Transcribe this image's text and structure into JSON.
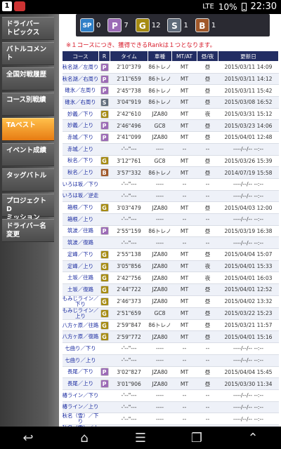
{
  "status_bar": {
    "badge": "1",
    "signal": "LTE",
    "battery": "10%",
    "time": "22:30"
  },
  "sidebar": {
    "items": [
      {
        "label": "ドライバー\nトピックス"
      },
      {
        "label": "バトルコメント"
      },
      {
        "label": "全国対戦履歴"
      },
      {
        "label": "コース別戦績"
      },
      {
        "label": "TAベスト"
      },
      {
        "label": "イベント成績"
      },
      {
        "label": "タッグバトル"
      },
      {
        "label": "プロジェクトD\nミッション"
      },
      {
        "label": "ドライバー名\n変更"
      }
    ]
  },
  "ranks": [
    {
      "letter": "SP",
      "count": "0",
      "color": "#2f7fc7"
    },
    {
      "letter": "P",
      "count": "7",
      "color": "#9c6bb6"
    },
    {
      "letter": "G",
      "count": "12",
      "color": "#a68b12"
    },
    {
      "letter": "S",
      "count": "1",
      "color": "#5f6b7a"
    },
    {
      "letter": "B",
      "count": "1",
      "color": "#a0582a"
    }
  ],
  "note": "※１コースにつき、獲得できるRankは１つとなります。",
  "table": {
    "headers": [
      "コース",
      "R",
      "タイム",
      "車種",
      "MT/AT",
      "昼/夜",
      "更新日"
    ],
    "rows": [
      {
        "course": "秋名湖／左周り",
        "rank": "P",
        "time": "2'10\"379",
        "car": "86トレノ",
        "mt": "MT",
        "daynight": "昼",
        "date": "2015/03/11 14:09"
      },
      {
        "course": "秋名湖／右周り",
        "rank": "P",
        "time": "2'11\"659",
        "car": "86トレノ",
        "mt": "MT",
        "daynight": "昼",
        "date": "2015/03/11 14:12"
      },
      {
        "course": "碓氷／左周り",
        "rank": "P",
        "time": "2'45\"738",
        "car": "86トレノ",
        "mt": "MT",
        "daynight": "昼",
        "date": "2015/03/11 15:42"
      },
      {
        "course": "碓氷／右周り",
        "rank": "S",
        "time": "3'04\"919",
        "car": "86トレノ",
        "mt": "MT",
        "daynight": "昼",
        "date": "2015/03/08 16:52"
      },
      {
        "course": "妙義／下り",
        "rank": "G",
        "time": "2'42\"610",
        "car": "JZA80",
        "mt": "MT",
        "daynight": "夜",
        "date": "2015/03/31 15:12"
      },
      {
        "course": "妙義／上り",
        "rank": "P",
        "time": "2'46\"496",
        "car": "GC8",
        "mt": "MT",
        "daynight": "昼",
        "date": "2015/03/23 14:06"
      },
      {
        "course": "赤城／下り",
        "rank": "P",
        "time": "2'41\"099",
        "car": "JZA80",
        "mt": "MT",
        "daynight": "昼",
        "date": "2015/04/01 12:48"
      },
      {
        "course": "赤城／上り",
        "rank": "",
        "time": "-'--\"---",
        "car": "----",
        "mt": "--",
        "daynight": "--",
        "date": "----/--/-- --:--"
      },
      {
        "course": "秋名／下り",
        "rank": "G",
        "time": "3'12\"761",
        "car": "GC8",
        "mt": "MT",
        "daynight": "昼",
        "date": "2015/03/26 15:39"
      },
      {
        "course": "秋名／上り",
        "rank": "B",
        "time": "3'57\"332",
        "car": "86トレノ",
        "mt": "MT",
        "daynight": "昼",
        "date": "2014/07/19 15:58"
      },
      {
        "course": "いろは坂／下り",
        "rank": "",
        "time": "-'--\"---",
        "car": "----",
        "mt": "--",
        "daynight": "--",
        "date": "----/--/-- --:--"
      },
      {
        "course": "いろは坂／逆走",
        "rank": "",
        "time": "-'--\"---",
        "car": "----",
        "mt": "--",
        "daynight": "--",
        "date": "----/--/-- --:--"
      },
      {
        "course": "箱根／下り",
        "rank": "G",
        "time": "3'03\"479",
        "car": "JZA80",
        "mt": "MT",
        "daynight": "昼",
        "date": "2015/04/03 12:00"
      },
      {
        "course": "箱根／上り",
        "rank": "",
        "time": "-'--\"---",
        "car": "----",
        "mt": "--",
        "daynight": "--",
        "date": "----/--/-- --:--"
      },
      {
        "course": "筑波／往路",
        "rank": "P",
        "time": "2'55\"159",
        "car": "86トレノ",
        "mt": "MT",
        "daynight": "昼",
        "date": "2015/03/19 16:38"
      },
      {
        "course": "筑波／復路",
        "rank": "",
        "time": "-'--\"---",
        "car": "----",
        "mt": "--",
        "daynight": "--",
        "date": "----/--/-- --:--"
      },
      {
        "course": "定峰／下り",
        "rank": "G",
        "time": "2'55\"138",
        "car": "JZA80",
        "mt": "MT",
        "daynight": "昼",
        "date": "2015/04/04 15:07"
      },
      {
        "course": "定峰／上り",
        "rank": "G",
        "time": "3'05\"856",
        "car": "JZA80",
        "mt": "MT",
        "daynight": "夜",
        "date": "2015/04/01 15:33"
      },
      {
        "course": "土坂／往路",
        "rank": "G",
        "time": "2'42\"756",
        "car": "JZA80",
        "mt": "MT",
        "daynight": "夜",
        "date": "2015/04/01 16:03"
      },
      {
        "course": "土坂／復路",
        "rank": "G",
        "time": "2'44\"722",
        "car": "JZA80",
        "mt": "MT",
        "daynight": "昼",
        "date": "2015/04/01 12:52"
      },
      {
        "course": "もみじライン／下り",
        "rank": "G",
        "time": "2'46\"373",
        "car": "JZA80",
        "mt": "MT",
        "daynight": "昼",
        "date": "2015/04/02 13:32"
      },
      {
        "course": "もみじライン／上り",
        "rank": "G",
        "time": "2'51\"659",
        "car": "GC8",
        "mt": "MT",
        "daynight": "昼",
        "date": "2015/03/22 15:23"
      },
      {
        "course": "八方ヶ原／往路",
        "rank": "G",
        "time": "2'59\"847",
        "car": "86トレノ",
        "mt": "MT",
        "daynight": "昼",
        "date": "2015/03/21 11:57"
      },
      {
        "course": "八方ヶ原／復路",
        "rank": "G",
        "time": "2'59\"772",
        "car": "JZA80",
        "mt": "MT",
        "daynight": "昼",
        "date": "2015/04/01 15:16"
      },
      {
        "course": "七曲り／下り",
        "rank": "",
        "time": "-'--\"---",
        "car": "----",
        "mt": "--",
        "daynight": "--",
        "date": "----/--/-- --:--"
      },
      {
        "course": "七曲り／上り",
        "rank": "",
        "time": "-'--\"---",
        "car": "----",
        "mt": "--",
        "daynight": "--",
        "date": "----/--/-- --:--"
      },
      {
        "course": "長尾／下り",
        "rank": "P",
        "time": "3'02\"827",
        "car": "JZA80",
        "mt": "MT",
        "daynight": "昼",
        "date": "2015/04/04 15:45"
      },
      {
        "course": "長尾／上り",
        "rank": "P",
        "time": "3'01\"906",
        "car": "JZA80",
        "mt": "MT",
        "daynight": "昼",
        "date": "2015/03/30 11:34"
      },
      {
        "course": "椿ライン／下り",
        "rank": "",
        "time": "-'--\"---",
        "car": "----",
        "mt": "--",
        "daynight": "--",
        "date": "----/--/-- --:--"
      },
      {
        "course": "椿ライン／上り",
        "rank": "",
        "time": "-'--\"---",
        "car": "----",
        "mt": "--",
        "daynight": "--",
        "date": "----/--/-- --:--"
      },
      {
        "course": "秋名（雪）／下り",
        "rank": "",
        "time": "-'--\"---",
        "car": "----",
        "mt": "--",
        "daynight": "--",
        "date": "----/--/-- --:--"
      },
      {
        "course": "秋名（雪）／上り",
        "rank": "",
        "time": "-'--\"---",
        "car": "----",
        "mt": "--",
        "daynight": "--",
        "date": "----/--/-- --:--"
      }
    ]
  },
  "rank_colors": {
    "P": "#9c6bb6",
    "G": "#a68b12",
    "S": "#5f6b7a",
    "B": "#a0582a"
  },
  "navbar": {
    "back": "↩",
    "home": "⌂",
    "menu": "☰",
    "recent": "❐",
    "up": "⌃"
  }
}
